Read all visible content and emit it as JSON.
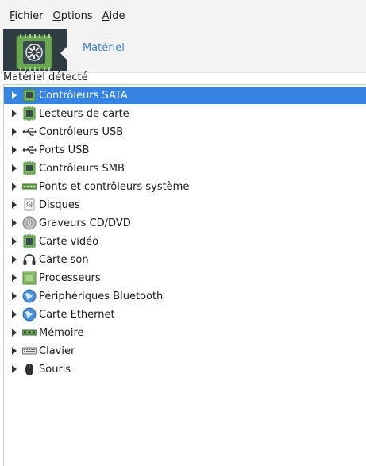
{
  "menu": {
    "fichier_mnem": "F",
    "fichier_rest": "ichier",
    "options_mnem": "O",
    "options_rest": "ptions",
    "aide_mnem": "A",
    "aide_rest": "ide"
  },
  "banner": {
    "title": "Matériel"
  },
  "section": {
    "label": "Matériel détecté"
  },
  "tree": {
    "items": [
      {
        "label": "Contrôleurs SATA",
        "icon": "chip-icon",
        "selected": true
      },
      {
        "label": "Lecteurs de carte",
        "icon": "chip-icon"
      },
      {
        "label": "Contrôleurs USB",
        "icon": "usb-icon"
      },
      {
        "label": "Ports USB",
        "icon": "usb-icon"
      },
      {
        "label": "Contrôleurs SMB",
        "icon": "chip-icon"
      },
      {
        "label": "Ponts et contrôleurs système",
        "icon": "bridge-icon"
      },
      {
        "label": "Disques",
        "icon": "disk-icon"
      },
      {
        "label": "Graveurs CD/DVD",
        "icon": "cd-icon"
      },
      {
        "label": "Carte vidéo",
        "icon": "chip-icon"
      },
      {
        "label": "Carte son",
        "icon": "headphones-icon"
      },
      {
        "label": "Processeurs",
        "icon": "cpu-icon"
      },
      {
        "label": "Périphériques Bluetooth",
        "icon": "globe-icon"
      },
      {
        "label": "Carte Ethernet",
        "icon": "globe-icon"
      },
      {
        "label": "Mémoire",
        "icon": "memory-icon"
      },
      {
        "label": "Clavier",
        "icon": "keyboard-icon"
      },
      {
        "label": "Souris",
        "icon": "mouse-icon"
      }
    ]
  },
  "colors": {
    "selection": "#3584e4",
    "accent_text": "#3d7fc7",
    "chip_green": "#7bb661"
  }
}
